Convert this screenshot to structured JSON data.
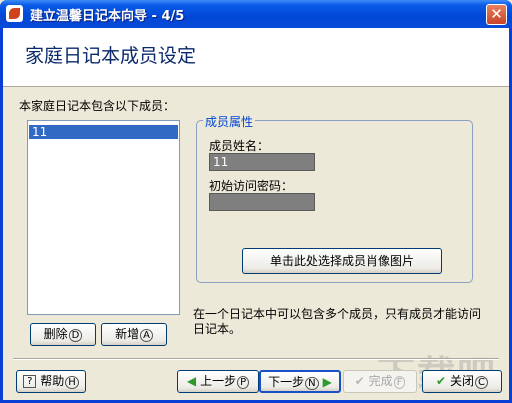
{
  "window": {
    "title": "建立温馨日记本向导 - 4/5",
    "close_symbol": "✕"
  },
  "header": {
    "title": "家庭日记本成员设定"
  },
  "members": {
    "label": "本家庭日记本包含以下成员：",
    "items": [
      "11"
    ],
    "delete_label": "删除",
    "delete_key": "D",
    "add_label": "新增",
    "add_key": "A"
  },
  "properties": {
    "legend": "成员属性",
    "name_label": "成员姓名：",
    "name_value": "11",
    "password_label": "初始访问密码：",
    "password_value": "",
    "portrait_button": "单击此处选择成员肖像图片"
  },
  "hint": "在一个日记本中可以包含多个成员，只有成员才能访问日记本。",
  "footer": {
    "help_label": "帮助",
    "help_key": "H",
    "prev_label": "上一步",
    "prev_key": "P",
    "next_label": "下一步",
    "next_key": "N",
    "finish_label": "完成",
    "finish_key": "F",
    "close_label": "关闭",
    "close_key": "C"
  },
  "watermark": "下载吧",
  "colors": {
    "titlebar": "#0047D6",
    "selection": "#316AC5",
    "accent_green": "#2E9A2E"
  },
  "icons": [
    "app-icon",
    "close-icon",
    "help-icon",
    "left-arrow-icon",
    "right-arrow-icon",
    "checkmark-icon"
  ]
}
